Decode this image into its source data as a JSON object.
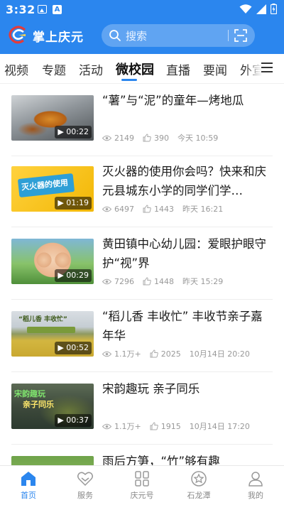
{
  "status_bar": {
    "time": "3:32"
  },
  "app": {
    "title": "掌上庆元"
  },
  "search": {
    "placeholder": "搜索"
  },
  "tabs": [
    {
      "label": "视频"
    },
    {
      "label": "专题"
    },
    {
      "label": "活动"
    },
    {
      "label": "微校园"
    },
    {
      "label": "直播"
    },
    {
      "label": "要闻"
    },
    {
      "label": "外宣"
    }
  ],
  "active_tab": "微校园",
  "feed": [
    {
      "title": "“薯”与“泥”的童年—烤地瓜",
      "duration": "00:22",
      "views": "2149",
      "likes": "390",
      "time": "今天 10:59"
    },
    {
      "title": "灭火器的使用你会吗？快来和庆元县城东小学的同学们学…",
      "duration": "01:19",
      "views": "6497",
      "likes": "1443",
      "time": "昨天 16:21",
      "thumb_caption": "灭火器的使用"
    },
    {
      "title": "黄田镇中心幼儿园：爱眼护眼守护“视”界",
      "duration": "00:29",
      "views": "7296",
      "likes": "1448",
      "time": "昨天 15:29"
    },
    {
      "title": "“稻儿香 丰收忙” 丰收节亲子嘉年华",
      "duration": "00:52",
      "views": "1.1万+",
      "likes": "2025",
      "time": "10月14日 20:20",
      "thumb_caption": "“稻儿香 丰收忙”"
    },
    {
      "title": "宋韵趣玩 亲子同乐",
      "duration": "00:37",
      "views": "1.1万+",
      "likes": "1915",
      "time": "10月14日 17:20",
      "thumb_caption": "宋韵趣玩",
      "thumb_caption2": "亲子同乐"
    },
    {
      "title": "雨后方笋，“竹”够有趣"
    }
  ],
  "bottom_nav": [
    {
      "label": "首页",
      "icon": "home-icon",
      "active": true
    },
    {
      "label": "服务",
      "icon": "heart-icon"
    },
    {
      "label": "庆元号",
      "icon": "grid-icon"
    },
    {
      "label": "石龙潭",
      "icon": "star-icon"
    },
    {
      "label": "我的",
      "icon": "profile-icon"
    }
  ],
  "colors": {
    "primary": "#2b86ee",
    "meta_text": "#999999",
    "title_text": "#1a1a1a"
  }
}
